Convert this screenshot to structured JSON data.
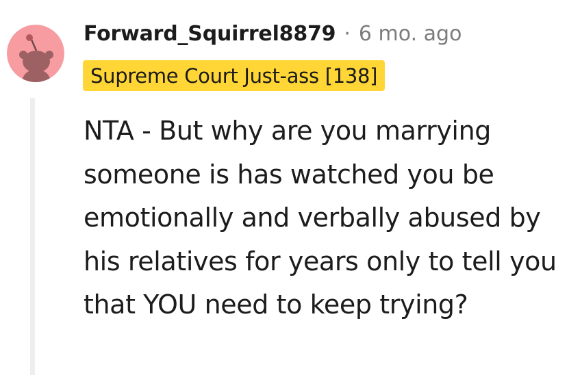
{
  "comment": {
    "username": "Forward_Squirrel8879",
    "separator": "·",
    "timestamp": "6 mo. ago",
    "flair": "Supreme Court Just-ass [138]",
    "flair_color": "#ffd635",
    "avatar_icon": "reddit-snoo-avatar-icon",
    "avatar_bg": "#f79ca0",
    "body": "NTA - But why are you marrying someone is has watched you be emotionally and verbally abused by his relatives for years only to tell you that YOU need to keep trying?"
  }
}
